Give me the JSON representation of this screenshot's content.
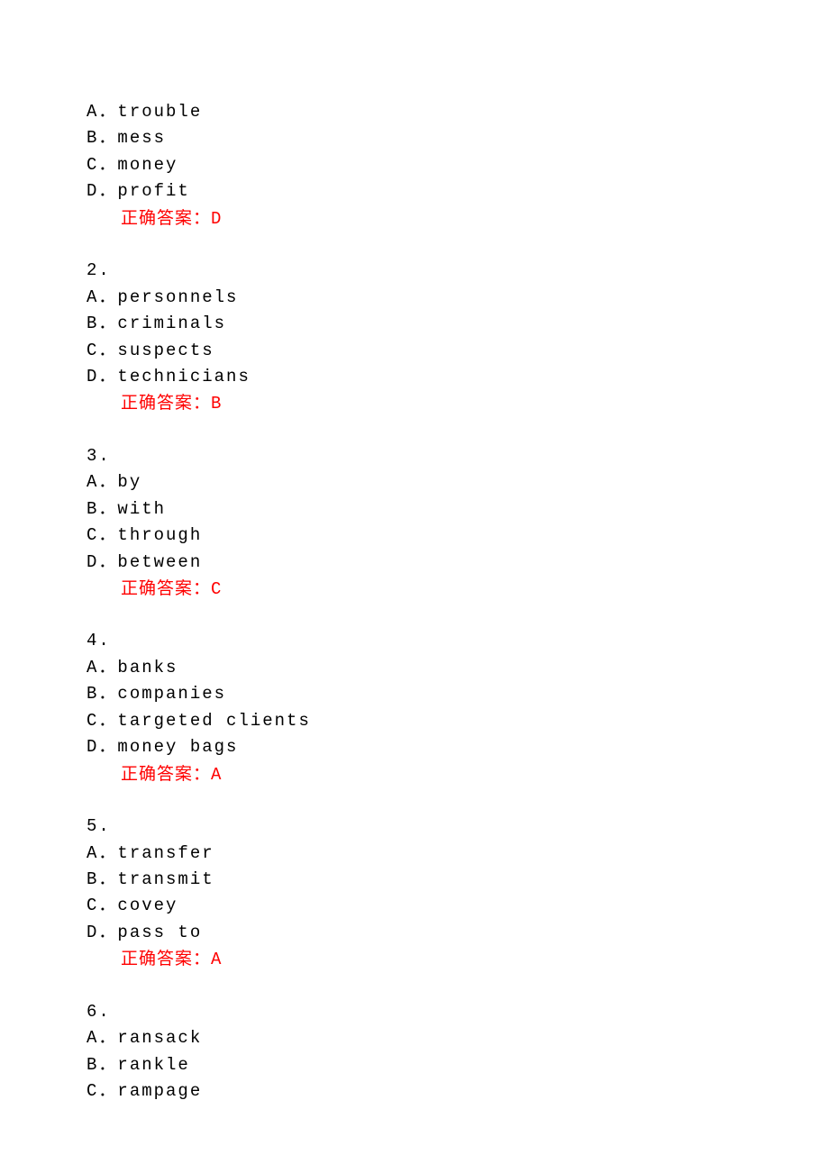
{
  "answer_prefix": "正确答案：",
  "questions": [
    {
      "number": "",
      "options": [
        {
          "label": "A",
          "text": "trouble"
        },
        {
          "label": "B",
          "text": "mess"
        },
        {
          "label": "C",
          "text": "money"
        },
        {
          "label": "D",
          "text": "profit"
        }
      ],
      "answer": "D"
    },
    {
      "number": "2.",
      "options": [
        {
          "label": "A",
          "text": "personnels"
        },
        {
          "label": "B",
          "text": "criminals"
        },
        {
          "label": "C",
          "text": "suspects"
        },
        {
          "label": "D",
          "text": "technicians"
        }
      ],
      "answer": "B"
    },
    {
      "number": "3.",
      "options": [
        {
          "label": "A",
          "text": "by"
        },
        {
          "label": "B",
          "text": "with"
        },
        {
          "label": "C",
          "text": "through"
        },
        {
          "label": "D",
          "text": "between"
        }
      ],
      "answer": "C"
    },
    {
      "number": "4.",
      "options": [
        {
          "label": "A",
          "text": "banks"
        },
        {
          "label": "B",
          "text": "companies"
        },
        {
          "label": "C",
          "text": "targeted clients"
        },
        {
          "label": "D",
          "text": "money bags"
        }
      ],
      "answer": "A"
    },
    {
      "number": "5.",
      "options": [
        {
          "label": "A",
          "text": "transfer"
        },
        {
          "label": "B",
          "text": "transmit"
        },
        {
          "label": "C",
          "text": "covey"
        },
        {
          "label": "D",
          "text": "pass to"
        }
      ],
      "answer": "A"
    },
    {
      "number": "6.",
      "options": [
        {
          "label": "A",
          "text": "ransack"
        },
        {
          "label": "B",
          "text": "rankle"
        },
        {
          "label": "C",
          "text": "rampage"
        }
      ],
      "answer": ""
    }
  ]
}
